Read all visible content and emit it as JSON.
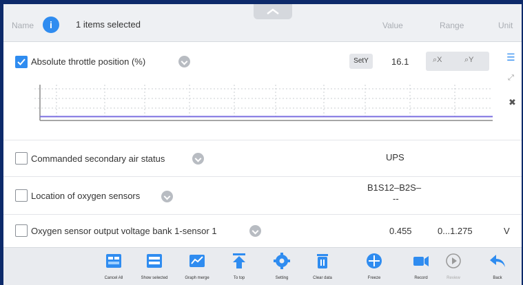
{
  "header": {
    "name_label": "Name",
    "info_glyph": "i",
    "selected_text": "1 items selected",
    "value_label": "Value",
    "range_label": "Range",
    "unit_label": "Unit"
  },
  "rows": [
    {
      "label": "Absolute throttle position  (%)",
      "checked": true,
      "sety_label": "SetY",
      "value": "16.1",
      "zoom_x_label": "X",
      "zoom_y_label": "Y",
      "graph": {
        "line_color": "#7b6fe0",
        "value_fraction": 0.05
      }
    },
    {
      "label": "Commanded secondary air status",
      "checked": false,
      "value": "UPS"
    },
    {
      "label": "Location of oxygen sensors",
      "checked": false,
      "value_line1": "B1S12–B2S–",
      "value_line2": "--"
    },
    {
      "label": "Oxygen sensor output voltage bank 1-sensor 1",
      "checked": false,
      "value": "0.455",
      "range": "0...1.275",
      "unit": "V"
    }
  ],
  "toolbar": {
    "items": [
      {
        "label": "Cancel All"
      },
      {
        "label": "Show selected"
      },
      {
        "label": "Graph merge"
      },
      {
        "label": "To top"
      },
      {
        "label": "Setting"
      },
      {
        "label": "Clear data"
      },
      {
        "label": "Freeze"
      },
      {
        "label": "Record"
      },
      {
        "label": "Review"
      },
      {
        "label": "Back"
      }
    ]
  },
  "colors": {
    "accent": "#2f8cf0",
    "frame": "#0d2a6a"
  }
}
